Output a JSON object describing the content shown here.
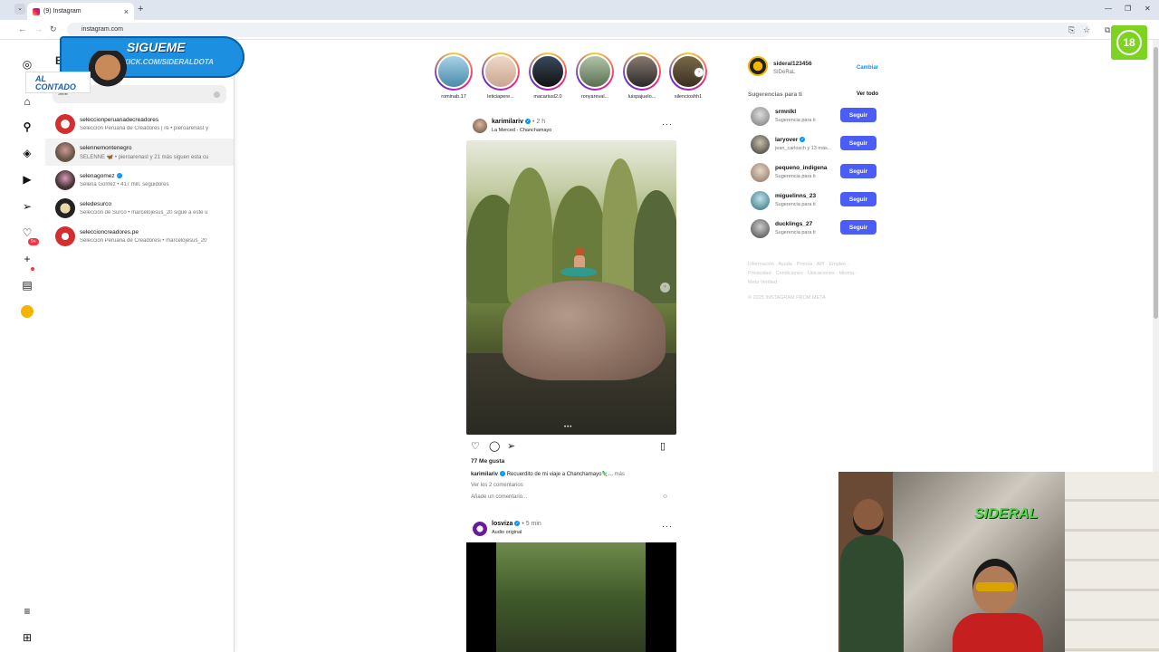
{
  "browser": {
    "tab_title": "(9) Instagram",
    "url": "instagram.com",
    "new_tab": "+",
    "tab_close": "×"
  },
  "overlay": {
    "title": "SIGUEME",
    "url_text": "KICK.COM/SIDERALDOTA",
    "badge_line1": "AL",
    "badge_line2": "CONTADO",
    "age_badge": "18"
  },
  "rail": {
    "notifications_count": "9+"
  },
  "search_panel": {
    "title": "Bú",
    "query": "sele",
    "results": [
      {
        "username": "seleccionperuanadecreadores",
        "desc": "Selección Peruana de Creadores | re • pieroarenast y"
      },
      {
        "username": "selennemontenegro",
        "desc": "SELENNE 🦋 • pieroarenast y 21 más siguen esta cu"
      },
      {
        "username": "selenagomez",
        "desc": "Selena Gomez • 417 mill. seguidores",
        "verified": true
      },
      {
        "username": "seledesurco",
        "desc": "Selección de Surco • marcelojesus_20 sigue a este u"
      },
      {
        "username": "seleccioncreadores.pe",
        "desc": "Selección Peruana de Creadoresi • marcelojesus_20"
      }
    ]
  },
  "stories": [
    {
      "name": "rominab.17"
    },
    {
      "name": "leticiapere..."
    },
    {
      "name": "macariusl2.0"
    },
    {
      "name": "ronyareval..."
    },
    {
      "name": "luispajuelo..."
    },
    {
      "name": "silencioshh1"
    }
  ],
  "post1": {
    "username": "karimilariv",
    "time": "• 2 h",
    "location": "La Merced - Chanchamayo",
    "likes": "77 Me gusta",
    "caption_user": "karimilariv",
    "caption_text": "Recuerdito de mi viaje a Chanchamayo🦎...",
    "caption_more": "más",
    "view_comments": "Ver los 2 comentarios",
    "add_comment": "Añade un comentario..."
  },
  "post2": {
    "username": "losviza",
    "time": "• 5 min",
    "audio": "Audio original"
  },
  "sidebar": {
    "me_username": "sideral123456",
    "me_name": "SIDeRaL",
    "switch_label": "Cambiar",
    "suggestions_title": "Sugerencias para ti",
    "see_all": "Ver todo",
    "suggestions": [
      {
        "username": "srmnlkl",
        "sub": "Sugerencia para ti",
        "button": "Seguir"
      },
      {
        "username": "laryover",
        "sub": "jean_carlosch y 13 más...",
        "button": "Seguir",
        "verified": true
      },
      {
        "username": "pequeno_indigena",
        "sub": "Sugerencia para ti",
        "button": "Seguir"
      },
      {
        "username": "miguelinns_23",
        "sub": "Sugerencia para ti",
        "button": "Seguir"
      },
      {
        "username": "ducklings_27",
        "sub": "Sugerencia para ti",
        "button": "Seguir"
      }
    ],
    "footer": "Información · Ayuda · Prensa · API · Empleo · Privacidad · Condiciones · Ubicaciones · Idioma · Meta Verified",
    "copyright": "© 2025 INSTAGRAM FROM META"
  },
  "webcam": {
    "logo_text": "SIDERAL"
  },
  "colors": {
    "follow_button": "#4a5df9",
    "link_blue": "#0095f6",
    "overlay_blue": "#1d8fe0",
    "age_badge_green": "#7ed321"
  }
}
